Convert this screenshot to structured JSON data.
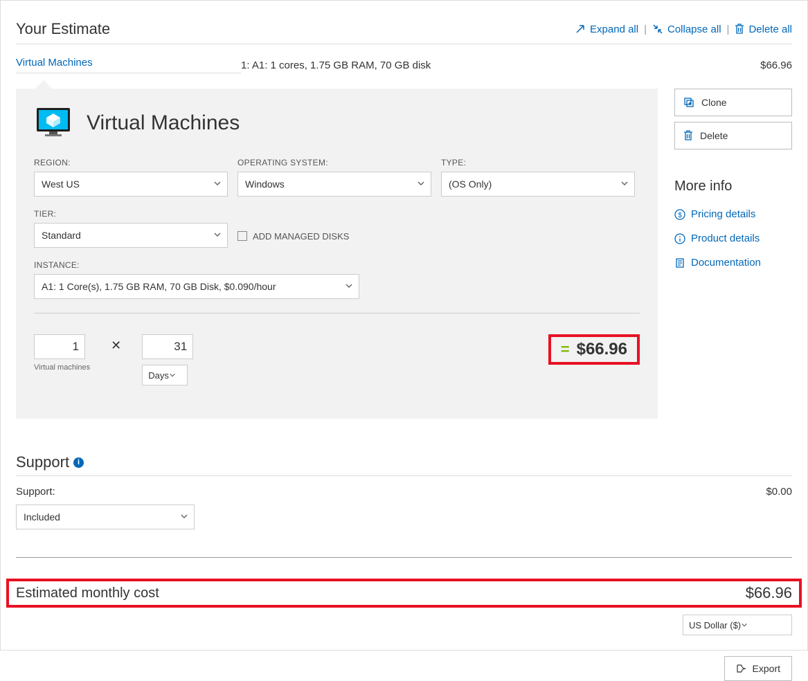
{
  "header": {
    "title": "Your Estimate",
    "expand_all": "Expand all",
    "collapse_all": "Collapse all",
    "delete_all": "Delete all"
  },
  "summary": {
    "service": "Virtual Machines",
    "desc": "1: A1: 1 cores, 1.75 GB RAM, 70 GB disk",
    "price": "$66.96"
  },
  "card": {
    "title": "Virtual Machines",
    "region_label": "REGION:",
    "region_value": "West US",
    "os_label": "OPERATING SYSTEM:",
    "os_value": "Windows",
    "type_label": "TYPE:",
    "type_value": "(OS Only)",
    "tier_label": "TIER:",
    "tier_value": "Standard",
    "managed_disks": "ADD MANAGED DISKS",
    "instance_label": "INSTANCE:",
    "instance_value": "A1: 1 Core(s), 1.75 GB RAM, 70 GB Disk, $0.090/hour",
    "vm_count": "1",
    "vm_count_label": "Virtual machines",
    "days": "31",
    "days_unit": "Days",
    "result": "$66.96"
  },
  "side": {
    "clone": "Clone",
    "delete": "Delete",
    "more_info": "More info",
    "pricing": "Pricing details",
    "product": "Product details",
    "docs": "Documentation"
  },
  "support": {
    "title": "Support",
    "label": "Support:",
    "price": "$0.00",
    "value": "Included"
  },
  "estimate": {
    "label": "Estimated monthly cost",
    "price": "$66.96",
    "currency": "US Dollar ($)"
  },
  "export_btn": "Export"
}
